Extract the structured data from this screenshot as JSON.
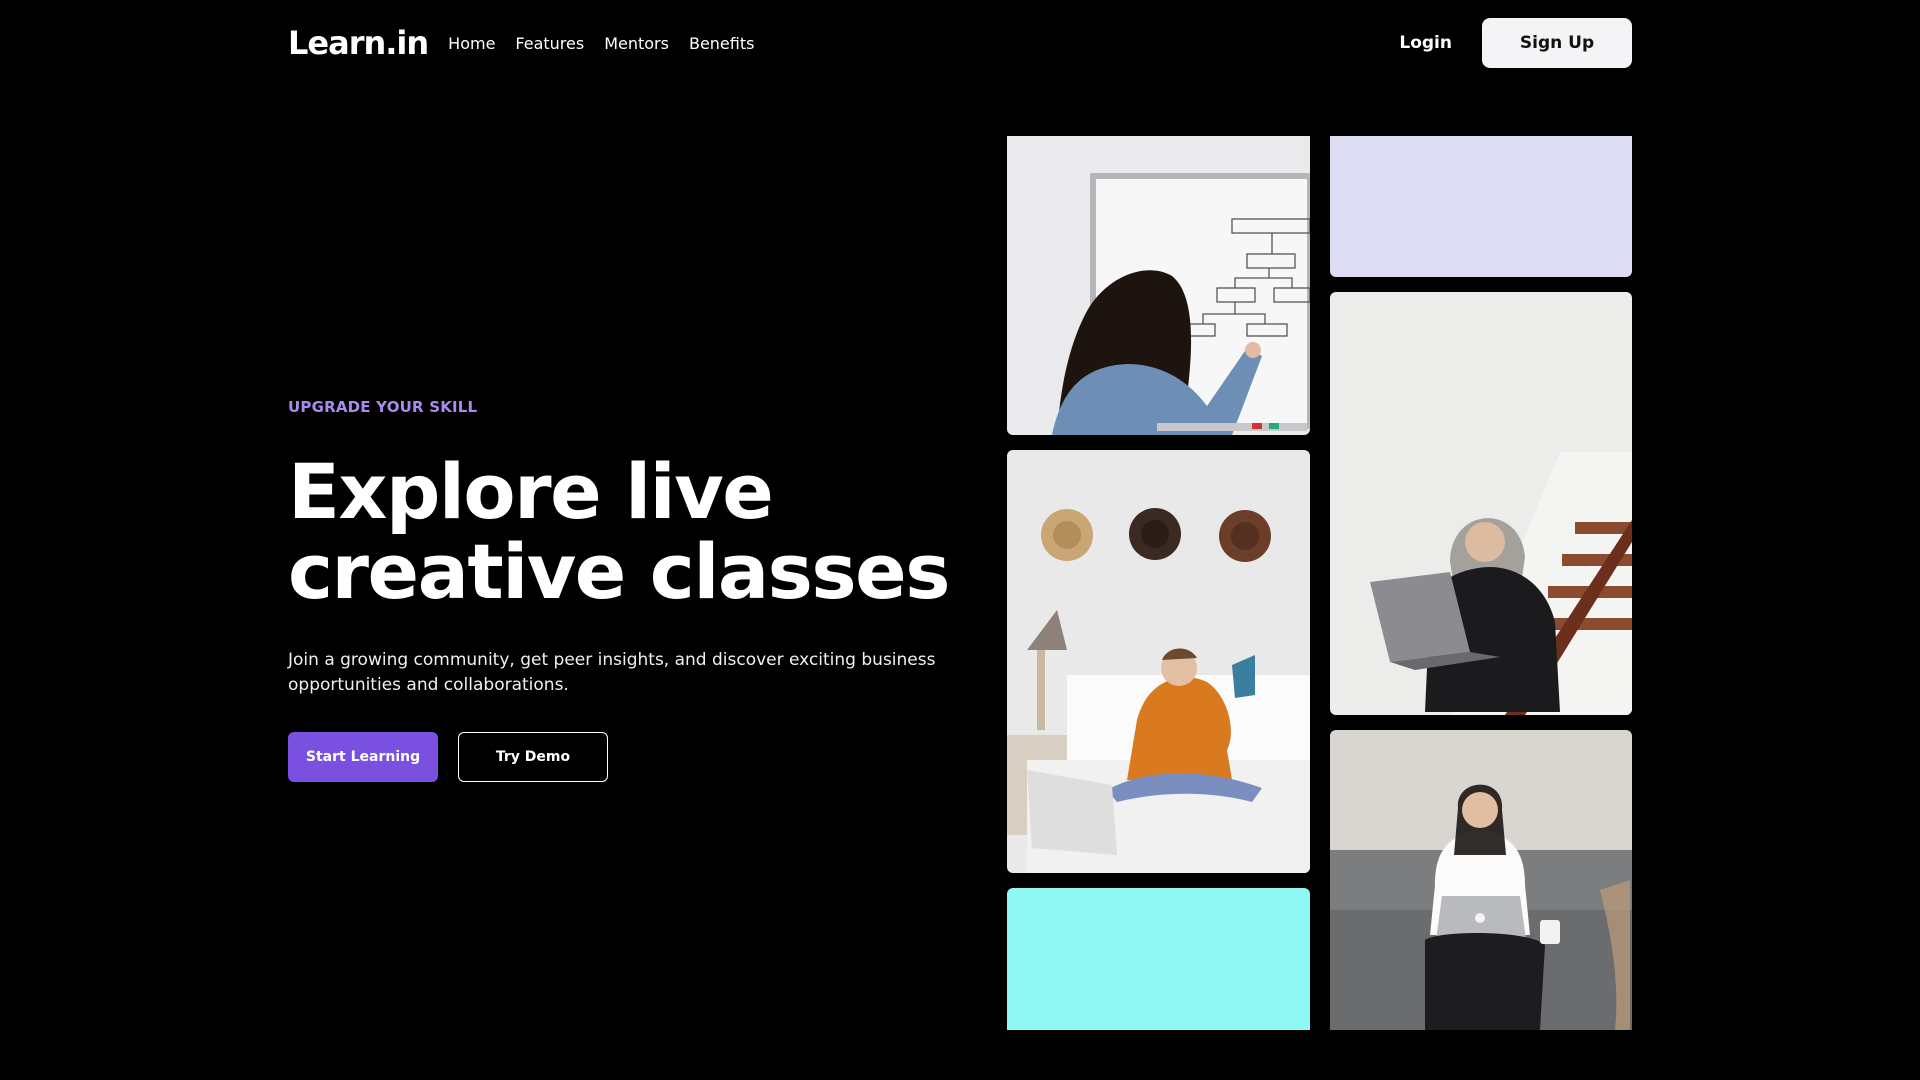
{
  "brand": {
    "logo": "Learn.in"
  },
  "nav": {
    "links": [
      "Home",
      "Features",
      "Mentors",
      "Benefits"
    ],
    "login_label": "Login",
    "signup_label": "Sign Up"
  },
  "hero": {
    "eyebrow": "UPGRADE YOUR SKILL",
    "headline_line1": "Explore live",
    "headline_line2": "creative classes",
    "lead": "Join a growing community, get peer insights, and discover exciting business opportunities and collaborations.",
    "primary_cta": "Start Learning",
    "secondary_cta": "Try Demo"
  },
  "colors": {
    "accent": "#7a50e0",
    "eyebrow": "#a98bf0",
    "cyan_tile": "#90f8f4",
    "lavender_tile": "#dcdcf2"
  },
  "gallery": {
    "tiles": [
      {
        "name": "whiteboard-photo"
      },
      {
        "name": "student-on-bed-photo"
      },
      {
        "name": "cyan-block"
      },
      {
        "name": "lavender-block"
      },
      {
        "name": "student-on-stairs-photo"
      },
      {
        "name": "student-on-sofa-photo"
      }
    ]
  }
}
